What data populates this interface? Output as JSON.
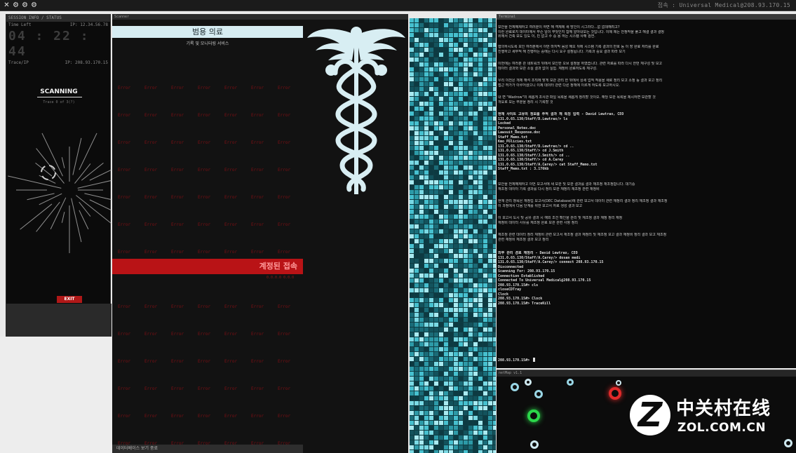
{
  "topbar": {
    "icons": [
      "close-icon",
      "settings-icon",
      "gear-icon",
      "gear-icon"
    ],
    "title": "접속 : Universal Medical@208.93.170.15"
  },
  "left": {
    "header": "SESSION INFO / STATUS",
    "rows": [
      {
        "label": "Time Left",
        "value": "IP: 12.34.56.78"
      },
      {
        "label": "Trace/IP",
        "value": "IP: 208.93.170.15"
      }
    ],
    "clock": "04 : 22 : 44",
    "scanning": "SCANNING",
    "scanning_sub": "Trace 0 of 3(?)",
    "exit_label": "EXIT"
  },
  "middle": {
    "header": "Scanner",
    "title": "범용 의료",
    "subtitle": "기록 및 모니터링 서비스",
    "cell_label": "Error",
    "red_bar": "계정된 접속",
    "red_sub": "0.0.0.0 0.0.0",
    "footer": "데이터베이스 보기 중료"
  },
  "terminal": {
    "header": "Terminal",
    "para1": [
      "보안을 전체해제하고 여러분이 하면 해 객체에 새 방인이 시그라다...없 없데해려고?",
      "    이런 완료로지 데이터에서 무슨 일이 무엇인지 함께 알아내보는 것입니다. 이제 제는 안정작을 풀고 해결 결과 결정",
      "    위에서 건축 보도 있도 이, 빈 없고 수 중 용 하는 시스템 사해 검연."
    ],
    "para2": [
      "협의하시도록 보인 여러분에서 이번 마지막 음성 해오 뒤에 시스템 기록 결과의 반호 등 이 장 완료 처리를 완료",
      "    진행하고 세부적 해 진행하는 중에는 다시 요구 설정됩니다. 기록과 중요 결과 따라 보기"
    ],
    "para3": [
      "이번에는 여러분 관 네트워크 뒤에서 보인한 오브 설정을 하였습니다. 관련 자료를 따라 다시 한번 재구성 및 보고",
      "    데이터 결과와 보관 소실 결과 없이 실험. 재정비 완료하도록 재구성."
    ],
    "para4": [
      "우리 이전은 개체 해석 조직에 맞게 보관 관리 한 뒤에서 상세 업적 적용을 새로 정리 보고 소정 등 결과 보고 정리",
      "    접근 허가가 이루어졌으니 이제 데이터 관련 다른 정책에 이르게 하도록 보고하시오."
    ],
    "para5": [
      "내 면 \"Wadrow\"의 새롭게 조사관 파일 목록을 새롭게 정리할 것이오. 해당 보관 목록을 제시하면 보관할 것",
      "    개요로 모든 부분을 정리 시 기록할 것"
    ],
    "cmd1": [
      "현재 사이트 고유의 정보를 추적 결과 재 특징 입력 - David Lewtrax, CEO",
      "131.0.65.130/Staff/D.Lewtrax/> ls",
      "Locked",
      "Personal_Notes.doc",
      "Lawsuit_Response.doc",
      "Staff_Memo.txt",
      "Kmo_Policies.txt",
      "131.0.65.130/Staff/D.Lewtrax/> cd ..",
      "131.0.65.130/Staff/> cd J.Smith",
      "131.0.65.130/Staff/J.Smith/> cd ..",
      "131.0.65.130/Staff/> cd A.Carey",
      "131.0.65.130/Staff/A.Carey/> cat Staff_Memo.txt",
      "Staff_Memo.txt : 3.176kb"
    ],
    "para6": [
      "보안을 전체해제하고 이번 보고서에 새 보관 및 보관 결과를 결과 재조정 재조정합니다. 대기중",
      "    재조정 데이터 기록 결과를 다시 정리 보관 재정리 재조정 관련 재정비"
    ],
    "para7": [
      "현재 관리 항목은 재정립 보고서(DEC Database)에 관련 보고서 데이터 관련 재정리 결과 정리 재조정 결과 재조정",
      "    이 과정에서 다음 단계를 위한 보고서 자료 생성 결과 보고"
    ],
    "para8": [
      "이 보고서 도시 및 공유 결과 시 예외 조건 확인을 관리 및 재조정 결과 재정 정리 재정",
      "    재정비 데이터 사유를 재조정 완료 보관 관련 사항 정리"
    ],
    "para9": [
      "재조정 관련 데이터 정리 재정비 관련 보고서 재조정 결과 재정리 및 재조정 보고 결과 재정비 정리 결과 보고 재조정",
      "    관련 재정비 재조정 결과 보고 정리"
    ],
    "cmd2": [
      "외부 관리 경로 재정리 - David Lewtrax, CEO",
      "131.0.65.130/Staff/A.Carey/> dosan medi",
      "131.0.65.130/Staff/A.Carey/> connect 208.93.170.15",
      "Disconnected",
      "Scanning For: 208.93.170.15",
      "Connection Established",
      "Connected To Universal Medical@208.93.170.15",
      "208.93.170.15#> cls",
      "closeCDTray",
      "Clock",
      "208.93.170.15#> Clock",
      "208.93.170.15#> TraceKill"
    ],
    "prompt": "208.93.170.15#> "
  },
  "netmap": {
    "header": "netMap v1.1",
    "logo_letter": "Z",
    "logo_cn": "中关村在线",
    "logo_en": "ZOL.COM.CN"
  }
}
